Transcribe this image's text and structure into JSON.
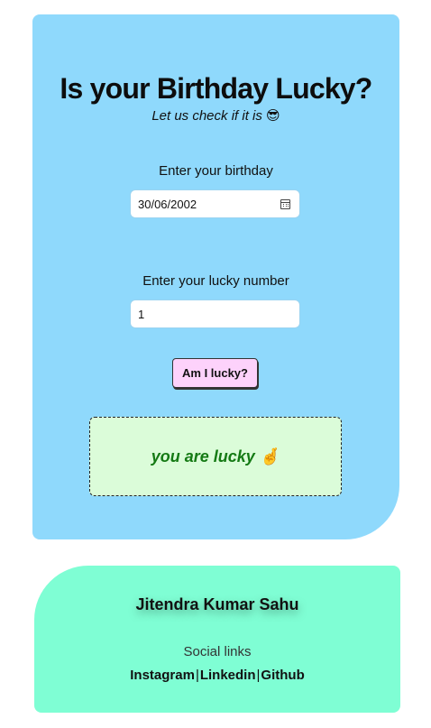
{
  "header": {
    "title": "Is your Birthday Lucky?",
    "subtitle": "Let us check if it is 😎"
  },
  "form": {
    "birthday_label": "Enter your birthday",
    "birthday_value": "30/06/2002",
    "lucky_label": "Enter your lucky number",
    "lucky_value": "1",
    "check_button": "Am I lucky?"
  },
  "result": {
    "message": "you are lucky 🤞"
  },
  "footer": {
    "author": "Jitendra Kumar Sahu",
    "social_label": "Social links",
    "links": [
      "Instagram",
      "Linkedin",
      "Github"
    ],
    "separator": "|"
  },
  "colors": {
    "card_bg": "#8fd9fc",
    "footer_bg": "#7ffed4",
    "button_bg": "#fdd2fb",
    "result_bg": "#dbfcd9",
    "result_text": "#147a14"
  }
}
